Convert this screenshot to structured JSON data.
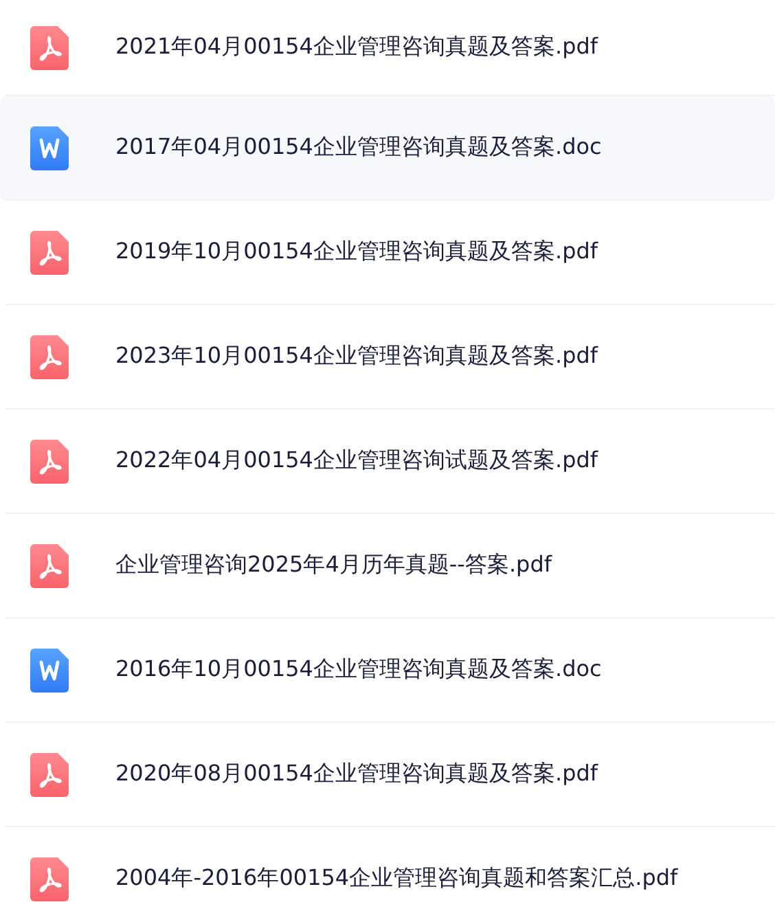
{
  "files": [
    {
      "name": "2021年04月00154企业管理咨询真题及答案.pdf",
      "kind": "pdf",
      "selected": false
    },
    {
      "name": "2017年04月00154企业管理咨询真题及答案.doc",
      "kind": "doc",
      "selected": true
    },
    {
      "name": "2019年10月00154企业管理咨询真题及答案.pdf",
      "kind": "pdf",
      "selected": false
    },
    {
      "name": "2023年10月00154企业管理咨询真题及答案.pdf",
      "kind": "pdf",
      "selected": false
    },
    {
      "name": "2022年04月00154企业管理咨询试题及答案.pdf",
      "kind": "pdf",
      "selected": false
    },
    {
      "name": "企业管理咨询2025年4月历年真题--答案.pdf",
      "kind": "pdf",
      "selected": false
    },
    {
      "name": "2016年10月00154企业管理咨询真题及答案.doc",
      "kind": "doc",
      "selected": false
    },
    {
      "name": "2020年08月00154企业管理咨询真题及答案.pdf",
      "kind": "pdf",
      "selected": false
    },
    {
      "name": "2004年-2016年00154企业管理咨询真题和答案汇总.pdf",
      "kind": "pdf",
      "selected": false
    }
  ]
}
